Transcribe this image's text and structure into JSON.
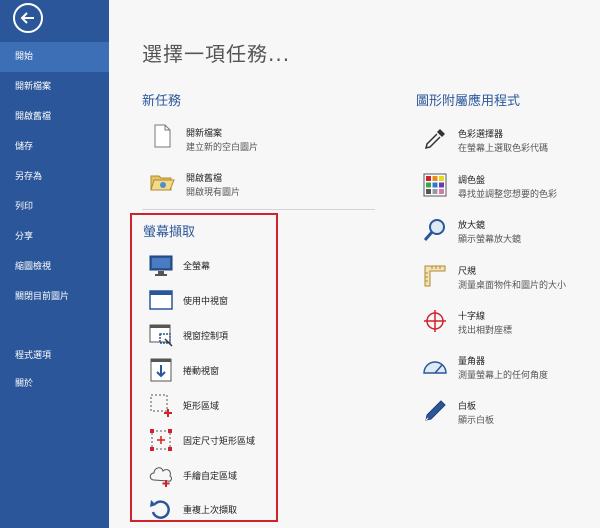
{
  "sidebar": {
    "items": [
      {
        "label": "開始"
      },
      {
        "label": "開新檔案"
      },
      {
        "label": "開啟舊檔"
      },
      {
        "label": "儲存"
      },
      {
        "label": "另存為"
      },
      {
        "label": "列印"
      },
      {
        "label": "分享"
      },
      {
        "label": "縮圖檢視"
      },
      {
        "label": "關閉目前圖片"
      },
      {
        "label": "程式選項"
      },
      {
        "label": "關於"
      }
    ]
  },
  "main": {
    "title": "選擇一項任務...",
    "new_task": {
      "heading": "新任務",
      "items": [
        {
          "title": "開新檔案",
          "desc": "建立新的空白圖片"
        },
        {
          "title": "開啟舊檔",
          "desc": "開啟現有圖片"
        }
      ]
    },
    "capture": {
      "heading": "螢幕擷取",
      "items": [
        {
          "label": "全螢幕"
        },
        {
          "label": "使用中視窗"
        },
        {
          "label": "視窗控制項"
        },
        {
          "label": "捲動視窗"
        },
        {
          "label": "矩形區域"
        },
        {
          "label": "固定尺寸矩形區域"
        },
        {
          "label": "手繪自定區域"
        },
        {
          "label": "重複上次擷取"
        }
      ]
    },
    "graphics_tools": {
      "heading": "圖形附屬應用程式",
      "items": [
        {
          "title": "色彩選擇器",
          "desc": "在螢幕上選取色彩代碼"
        },
        {
          "title": "調色盤",
          "desc": "尋找並調整您想要的色彩"
        },
        {
          "title": "放大鏡",
          "desc": "顯示螢幕放大鏡"
        },
        {
          "title": "尺規",
          "desc": "測量桌面物件和圖片的大小"
        },
        {
          "title": "十字線",
          "desc": "找出相對座標"
        },
        {
          "title": "量角器",
          "desc": "測量螢幕上的任何角度"
        },
        {
          "title": "白板",
          "desc": "顯示白板"
        }
      ]
    }
  },
  "colors": {
    "sidebar_bg": "#2b579a",
    "sidebar_active": "#3d6fb7",
    "accent_heading": "#2b579a",
    "highlight_border": "#d0222a"
  }
}
